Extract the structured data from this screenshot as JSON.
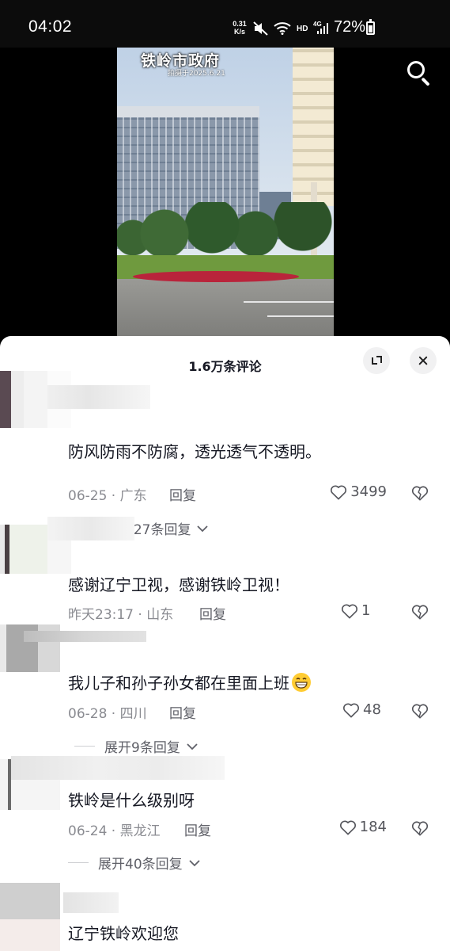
{
  "status_bar": {
    "time": "04:02",
    "net_speed": "0.31\nK/s",
    "net_speed_top": "0.31",
    "net_speed_bottom": "K/s",
    "hd": "HD",
    "signal": "4G",
    "battery": "72%",
    "battery_level": 0.72
  },
  "video": {
    "overlay_title": "铁岭市政府",
    "overlay_date": "拍摄于2025.6.21"
  },
  "panel": {
    "title": "1.6万条评论"
  },
  "comments": [
    {
      "text": "防风防雨不防腐，透光透气不透明。",
      "meta": "06-25 · 广东",
      "reply": "回复",
      "likes": "3499",
      "expand": "展开127条回复"
    },
    {
      "text": "感谢辽宁卫视，感谢铁岭卫视！",
      "meta": "昨天23:17 · 山东",
      "reply": "回复",
      "likes": "1",
      "expand": ""
    },
    {
      "text": "我儿子和孙子孙女都在里面上班",
      "meta": "06-28 · 四川",
      "reply": "回复",
      "likes": "48",
      "expand": "展开9条回复"
    },
    {
      "text": "铁岭是什么级别呀",
      "meta": "06-24 · 黑龙江",
      "reply": "回复",
      "likes": "184",
      "expand": "展开40条回复"
    },
    {
      "text": "辽宁铁岭欢迎您",
      "meta": "",
      "reply": "",
      "likes": "",
      "expand": ""
    }
  ],
  "colors": {
    "primary_text": "#161823",
    "secondary_text": "#8a8b91",
    "panel_bg": "#ffffff",
    "divider": "#cfd0d3"
  }
}
